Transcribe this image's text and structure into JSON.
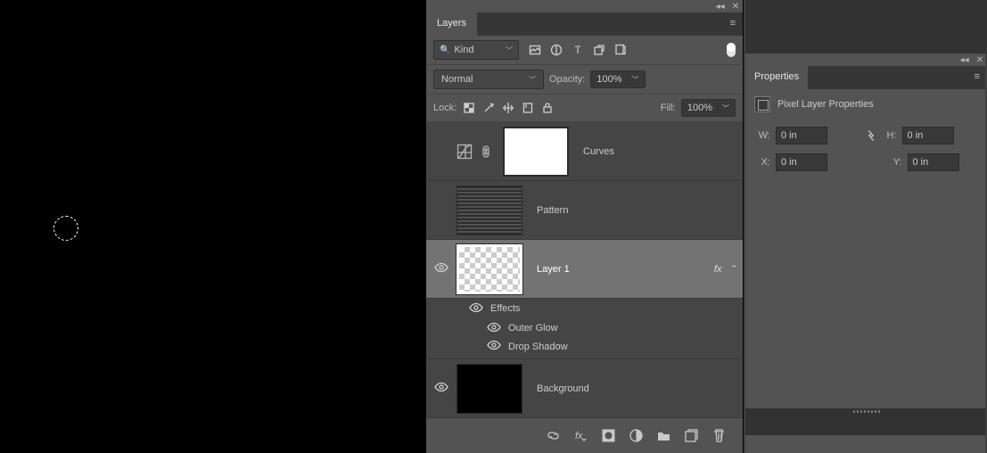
{
  "layers_panel": {
    "title": "Layers",
    "kind_label": "Kind",
    "blend_mode": "Normal",
    "opacity_label": "Opacity:",
    "opacity_value": "100%",
    "lock_label": "Lock:",
    "fill_label": "Fill:",
    "fill_value": "100%",
    "layers": [
      {
        "name": "Curves",
        "visible": false,
        "thumb": "white",
        "adjustment": true
      },
      {
        "name": "Pattern",
        "visible": false,
        "thumb": "pattern"
      },
      {
        "name": "Layer 1",
        "visible": true,
        "thumb": "checker",
        "selected": true,
        "fx": true
      },
      {
        "name": "Background",
        "visible": true,
        "thumb": "black"
      }
    ],
    "effects_header": "Effects",
    "effects": [
      "Outer Glow",
      "Drop Shadow"
    ]
  },
  "properties_panel": {
    "title": "Properties",
    "subtitle": "Pixel Layer Properties",
    "W_label": "W:",
    "W_value": "0 in",
    "H_label": "H:",
    "H_value": "0 in",
    "X_label": "X:",
    "X_value": "0 in",
    "Y_label": "Y:",
    "Y_value": "0 in"
  }
}
